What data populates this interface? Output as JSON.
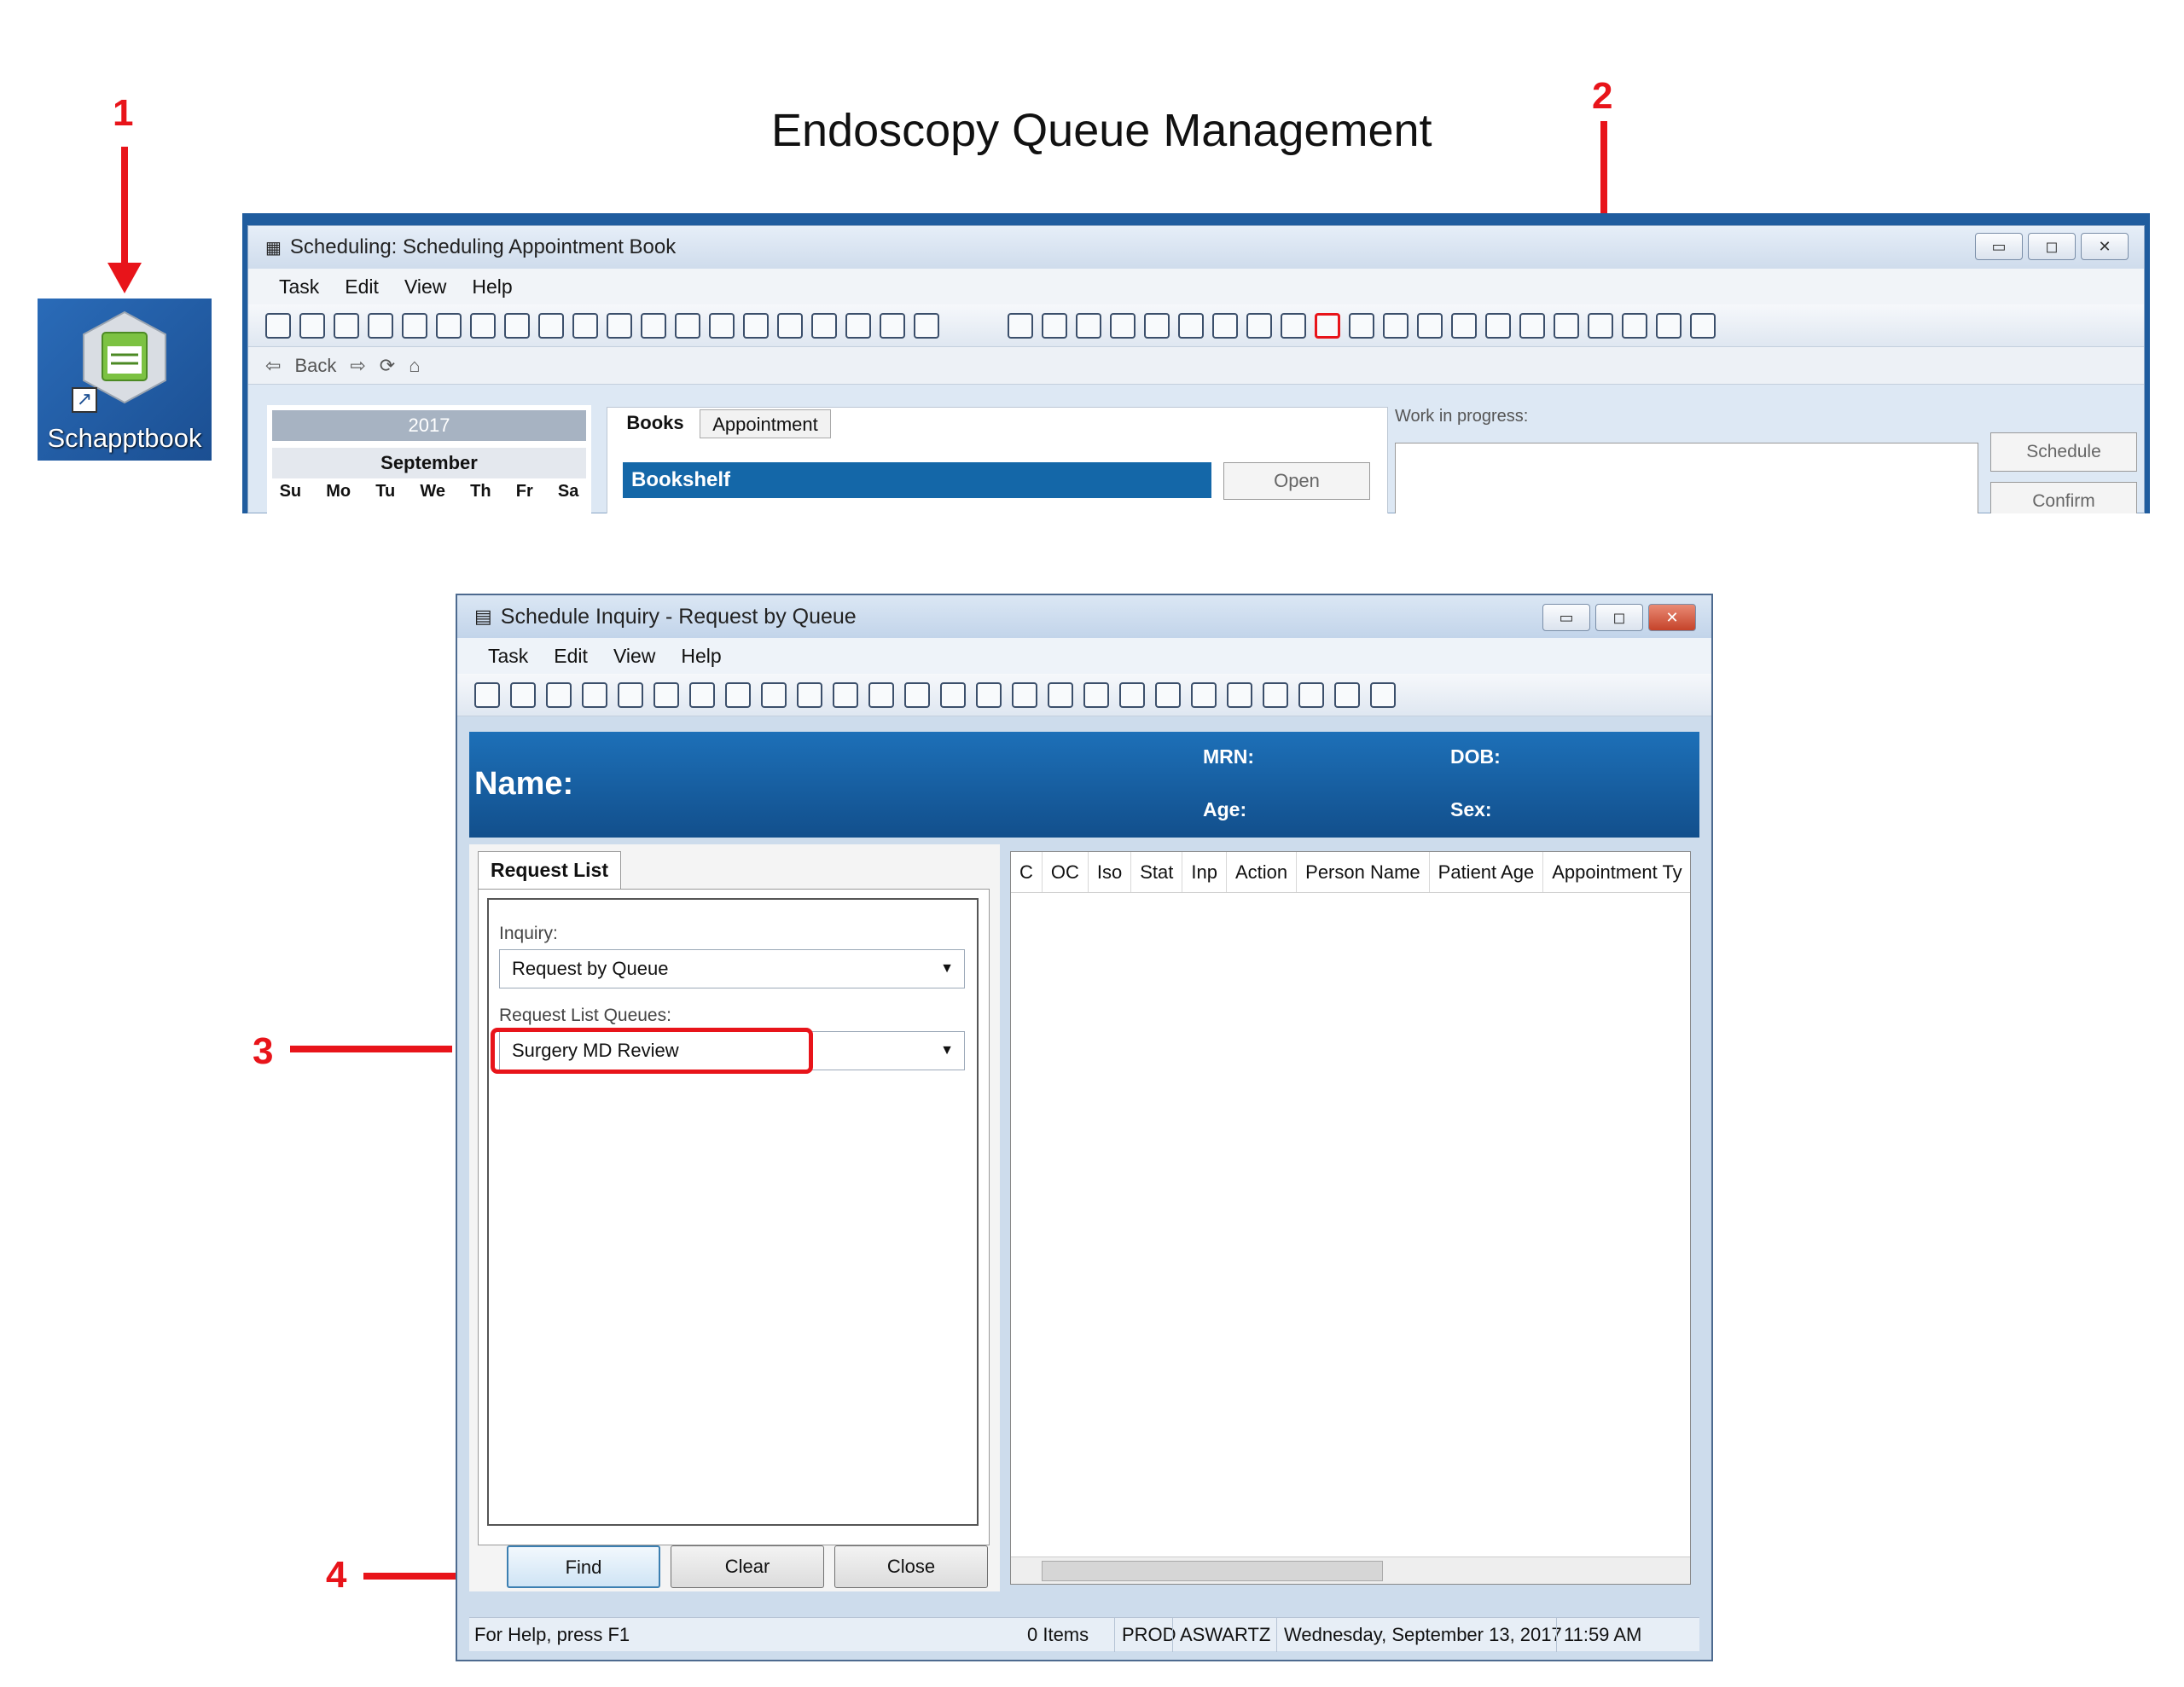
{
  "page_title": "Endoscopy Queue Management",
  "callouts": [
    "1",
    "2",
    "3",
    "4"
  ],
  "colors": {
    "callout": "#e8141a",
    "header_blue": "#1d70b8"
  },
  "desktop_icon": {
    "label": "Schapptbook",
    "icon": "calendar-app-icon"
  },
  "main_window": {
    "title": "Scheduling: Scheduling Appointment Book",
    "menu": [
      "Task",
      "Edit",
      "View",
      "Help"
    ],
    "nav": {
      "back": "Back"
    },
    "calendar": {
      "year": "2017",
      "month": "September",
      "days": [
        "Su",
        "Mo",
        "Tu",
        "We",
        "Th",
        "Fr",
        "Sa"
      ]
    },
    "tabs": [
      "Books",
      "Appointment"
    ],
    "bookshelf": "Bookshelf",
    "open_button": "Open",
    "work_in_progress": "Work in progress:",
    "schedule_button": "Schedule",
    "confirm_button": "Confirm"
  },
  "inquiry_window": {
    "title": "Schedule Inquiry -  Request by Queue",
    "menu": [
      "Task",
      "Edit",
      "View",
      "Help"
    ],
    "patient": {
      "name_label": "Name:",
      "mrn_label": "MRN:",
      "dob_label": "DOB:",
      "age_label": "Age:",
      "sex_label": "Sex:"
    },
    "tab": "Request List",
    "inquiry_label": "Inquiry:",
    "inquiry_value": "Request by Queue",
    "queues_label": "Request List Queues:",
    "queues_value": "Surgery MD Review",
    "columns": [
      "C",
      "OC",
      "Iso",
      "Stat",
      "Inp",
      "Action",
      "Person Name",
      "Patient Age",
      "Appointment Ty"
    ],
    "buttons": {
      "find": "Find",
      "clear": "Clear",
      "close": "Close"
    },
    "status": {
      "help": "For Help, press F1",
      "items": "0 Items",
      "env": "PROD",
      "user": "ASWARTZ",
      "date": "Wednesday, September 13, 2017",
      "time": "11:59 AM"
    }
  }
}
